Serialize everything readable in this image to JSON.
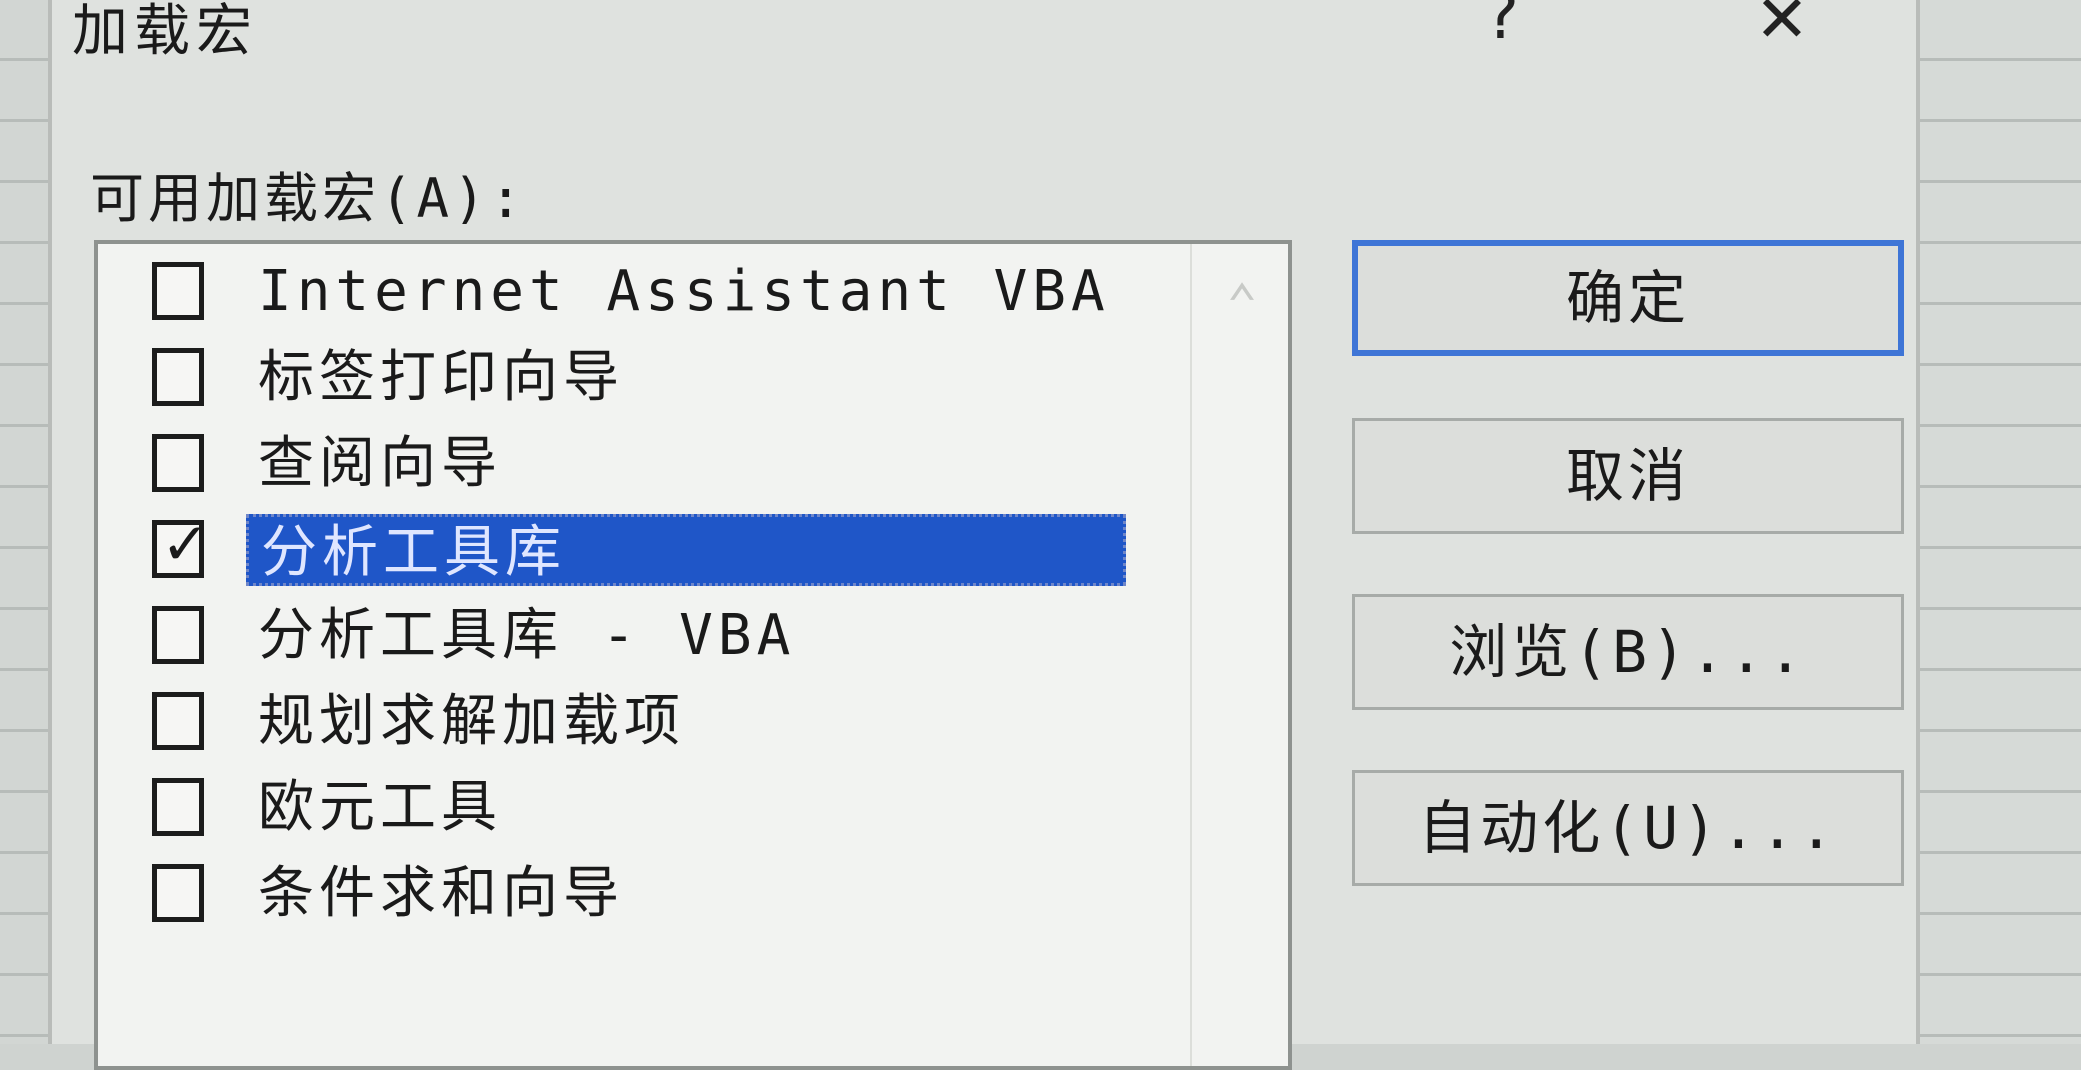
{
  "dialog": {
    "title": "加载宏",
    "help_glyph": "?",
    "close_glyph": "✕",
    "available_label": "可用加载宏(A):"
  },
  "addins": [
    {
      "label": "Internet Assistant VBA",
      "checked": false,
      "selected": false
    },
    {
      "label": "标签打印向导",
      "checked": false,
      "selected": false
    },
    {
      "label": "查阅向导",
      "checked": false,
      "selected": false
    },
    {
      "label": "分析工具库",
      "checked": true,
      "selected": true
    },
    {
      "label": "分析工具库 - VBA",
      "checked": false,
      "selected": false
    },
    {
      "label": "规划求解加载项",
      "checked": false,
      "selected": false
    },
    {
      "label": "欧元工具",
      "checked": false,
      "selected": false
    },
    {
      "label": "条件求和向导",
      "checked": false,
      "selected": false
    }
  ],
  "buttons": {
    "ok": "确定",
    "cancel": "取消",
    "browse": "浏览(B)...",
    "automation": "自动化(U)..."
  },
  "icons": {
    "check": "check-icon",
    "scroll_up": "chevron-up-icon",
    "close": "close-icon",
    "help": "help-icon"
  },
  "colors": {
    "selection": "#1f56c8",
    "default_button_border": "#3e75d6"
  }
}
